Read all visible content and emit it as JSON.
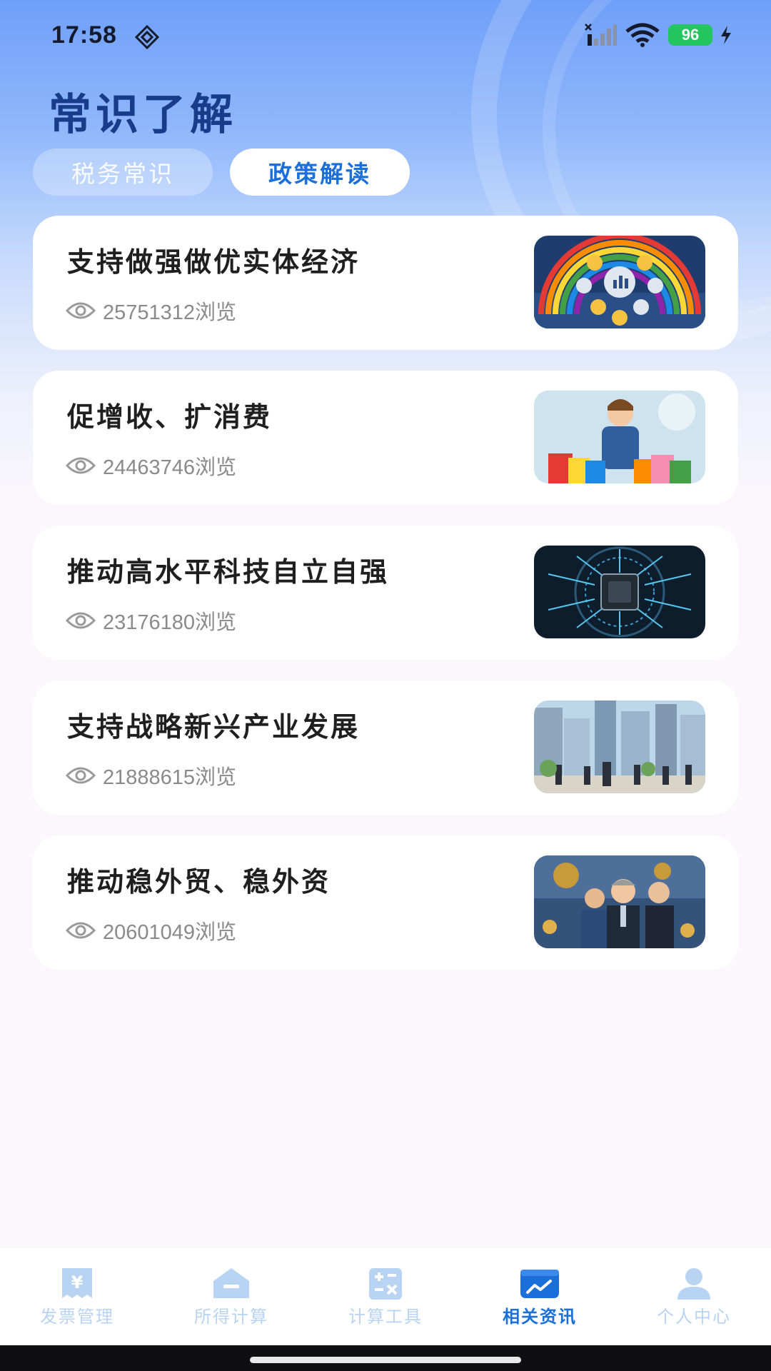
{
  "status_bar": {
    "time": "17:58",
    "battery": "96"
  },
  "page": {
    "title": "常识了解"
  },
  "tabs": [
    {
      "label": "税务常识",
      "active": false
    },
    {
      "label": "政策解读",
      "active": true
    }
  ],
  "articles": [
    {
      "title": "支持做强做优实体经济",
      "views": "25751312浏览",
      "thumbnail_icon": "rainbow-finance-icon"
    },
    {
      "title": "促增收、扩消费",
      "views": "24463746浏览",
      "thumbnail_icon": "shopper-bags-icon"
    },
    {
      "title": "推动高水平科技自立自强",
      "views": "23176180浏览",
      "thumbnail_icon": "chip-circuit-icon"
    },
    {
      "title": "支持战略新兴产业发展",
      "views": "21888615浏览",
      "thumbnail_icon": "city-buildings-icon"
    },
    {
      "title": "推动稳外贸、稳外资",
      "views": "20601049浏览",
      "thumbnail_icon": "businessmen-money-icon"
    }
  ],
  "bottom_nav": [
    {
      "label": "发票管理",
      "icon": "invoice-icon",
      "active": false
    },
    {
      "label": "所得计算",
      "icon": "income-calc-icon",
      "active": false
    },
    {
      "label": "计算工具",
      "icon": "calculator-icon",
      "active": false
    },
    {
      "label": "相关资讯",
      "icon": "news-chart-icon",
      "active": true
    },
    {
      "label": "个人中心",
      "icon": "person-icon",
      "active": false
    }
  ],
  "colors": {
    "accent": "#1a6fd8",
    "title": "#173d8a",
    "nav_inactive": "#b9d3f2",
    "battery": "#22c55e"
  }
}
